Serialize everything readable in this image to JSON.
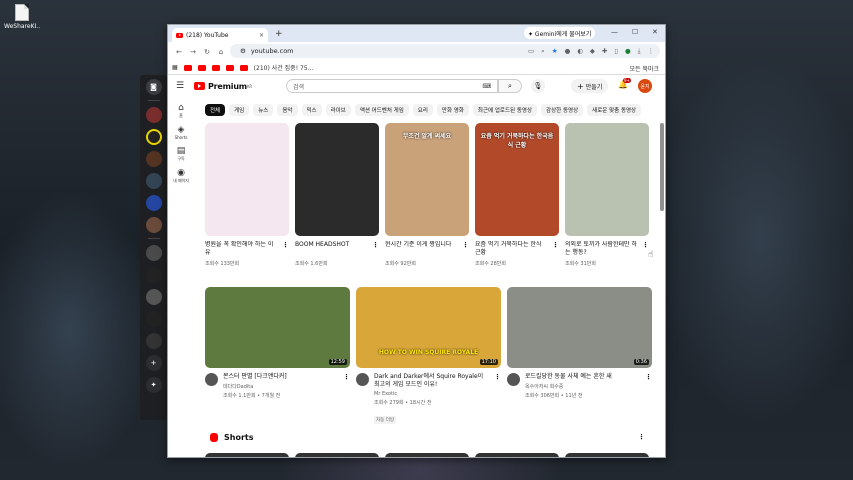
{
  "desktop": {
    "file_label": "WeShareKI..."
  },
  "tab": {
    "title": "(218) YouTube",
    "close": "×",
    "new_tab": "+"
  },
  "gemini": {
    "label": "✦ Gemini에게 물어보기"
  },
  "window_controls": {
    "min": "—",
    "max": "☐",
    "close": "✕"
  },
  "omnibox": {
    "url": "youtube.com"
  },
  "bookmarks": {
    "item": "(210) 사건 집중! 75...",
    "all": "모든 북마크"
  },
  "youtube": {
    "logo": "Premium",
    "logo_region": "KR",
    "search_placeholder": "검색",
    "create_label": "만들기",
    "notif_badge": "9+",
    "avatar_text": "윤지",
    "sidebar": [
      {
        "icon": "⌂",
        "label": "홈",
        "name": "home"
      },
      {
        "icon": "◈",
        "label": "Shorts",
        "name": "shorts"
      },
      {
        "icon": "▤",
        "label": "구독",
        "name": "subscriptions"
      },
      {
        "icon": "◉",
        "label": "내 페이지",
        "name": "you"
      }
    ],
    "chips": [
      "전체",
      "게임",
      "뉴스",
      "음악",
      "믹스",
      "라이브",
      "액션 어드벤처 게임",
      "요리",
      "만화 영화",
      "최근에 업로드된 동영상",
      "감상한 동영상",
      "새로운 맞춤 동영상"
    ],
    "shorts_cards": [
      {
        "title": "병원을 꼭 확인해야 하는 이유",
        "views": "조회수 133만회",
        "caption": "",
        "bg": "#f4e7ef"
      },
      {
        "title": "BOOM HEADSHOT",
        "views": "조회수 1.6만회",
        "caption": "",
        "bg": "#2b2b2b"
      },
      {
        "title": "현시간 기준 이게 짱입니다",
        "views": "조회수 92만회",
        "caption": "무조건 알게 써세요",
        "bg": "#c9a27a"
      },
      {
        "title": "요즘 먹기 거북하다는 한식 근황",
        "views": "조회수 28만회",
        "caption": "요즘 먹기 거북하다는 한국음식 근황",
        "bg": "#b24a2a"
      },
      {
        "title": "의외로 토끼가 사람한테만 하는 행동?",
        "views": "조회수 31만회",
        "caption": "",
        "bg": "#b9c2b0"
      }
    ],
    "long_videos": [
      {
        "title": "몬스터 판별 [다크앤다커]",
        "channel": "데다다Dadita",
        "stats": "조회수 1.1만회 • 7개월 전",
        "duration": "12:59",
        "badge": "",
        "bg": "#5e7a3e"
      },
      {
        "title": "Dark and Darker에서 Squire Royale이 최고의 게임 모드인 이유!",
        "channel": "Mr Exotic",
        "stats": "조회수 279회 • 18시간 전",
        "duration": "17:10",
        "badge": "자동 더빙",
        "bg": "#d9a63a"
      },
      {
        "title": "로드킬당한 동물 사체 예는 흔한 새",
        "channel": "옥수아저씨 회수중",
        "stats": "조회수 306만회 • 11년 전",
        "duration": "0:36",
        "badge": "",
        "bg": "#8a8e86"
      }
    ],
    "long_thumb_caption": "HOW TO WIN SQUIRE ROYALE",
    "shorts_section_title": "Shorts"
  }
}
